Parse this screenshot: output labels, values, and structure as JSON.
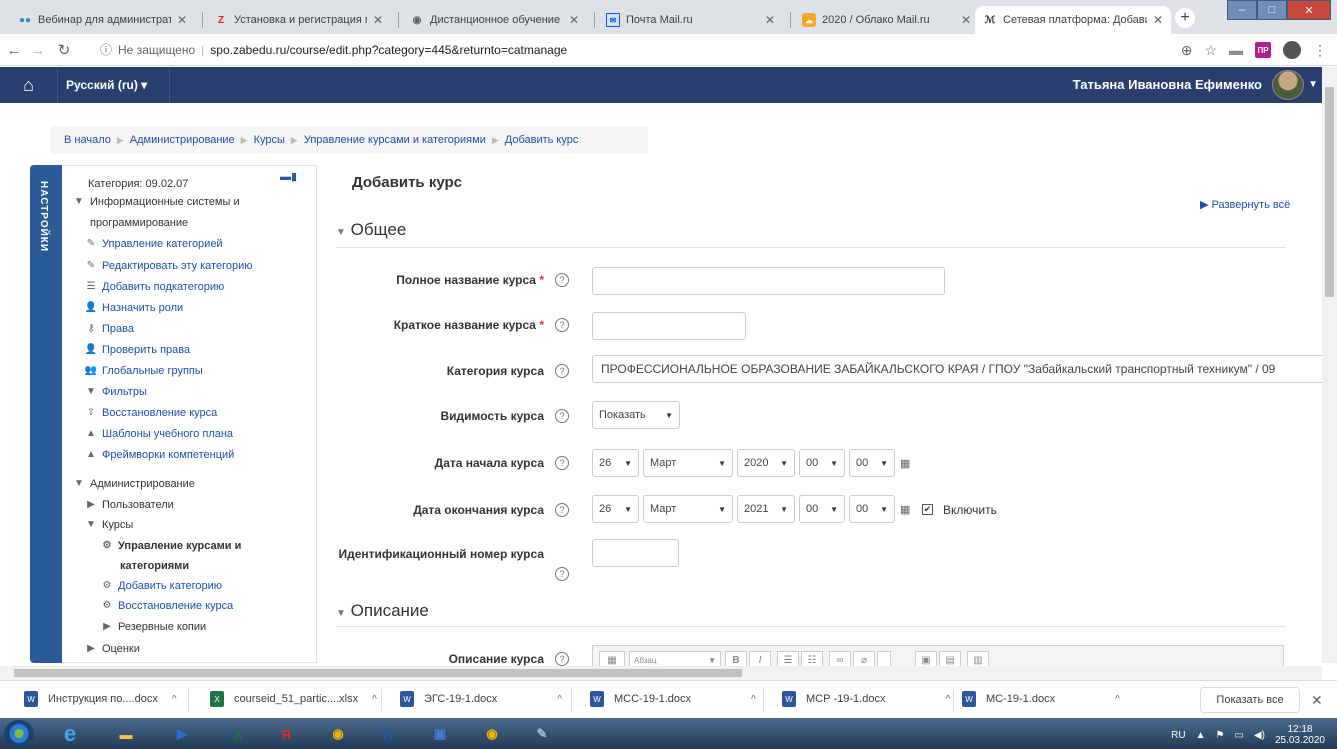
{
  "browser": {
    "tabs": [
      {
        "label": "Вебинар для администраторо",
        "icon": "webinar-icon",
        "active": false
      },
      {
        "label": "Установка и регистрация моб",
        "icon": "zoom-icon",
        "active": false
      },
      {
        "label": "Дистанционное обучение - ЧТ",
        "icon": "globe-icon",
        "active": false
      },
      {
        "label": "Почта Mail.ru",
        "icon": "mail-icon",
        "active": false
      },
      {
        "label": "2020 / Облако Mail.ru",
        "icon": "cloud-icon",
        "active": false
      },
      {
        "label": "Сетевая платформа: Добавить",
        "icon": "moodle-icon",
        "active": true
      }
    ],
    "address": {
      "insecure_label": "Не защищено",
      "url": "spo.zabedu.ru/course/edit.php?category=445&returnto=catmanage"
    }
  },
  "navbar": {
    "language": "Русский (ru) ▾",
    "username": "Татьяна Ивановна Ефименко"
  },
  "breadcrumb": [
    "В начало",
    "Администрирование",
    "Курсы",
    "Управление курсами и категориями",
    "Добавить курс"
  ],
  "settings": {
    "tab_label": "НАСТРОЙКИ",
    "category_title": "Категория: 09.02.07",
    "category_name_line1": "Информационные системы и",
    "category_name_line2": "программирование",
    "items": [
      "Управление категорией",
      "Редактировать эту категорию",
      "Добавить подкатегорию",
      "Назначить роли",
      "Права",
      "Проверить права",
      "Глобальные группы",
      "Фильтры",
      "Восстановление курса",
      "Шаблоны учебного плана",
      "Фреймворки компетенций"
    ],
    "admin": "Администрирование",
    "users": "Пользователи",
    "courses": "Курсы",
    "manage_courses_line1": "Управление курсами и",
    "manage_courses_line2": "категориями",
    "add_category": "Добавить категорию",
    "restore_course": "Восстановление курса",
    "backups": "Резервные копии",
    "grades": "Оценки"
  },
  "form": {
    "title": "Добавить курс",
    "expand_all": "Развернуть всё",
    "section_general": "Общее",
    "section_description": "Описание",
    "fullname_label": "Полное название курса",
    "shortname_label": "Краткое название курса",
    "category_label": "Категория курса",
    "category_value": "ПРОФЕССИОНАЛЬНОЕ ОБРАЗОВАНИЕ ЗАБАЙКАЛЬСКОГО КРАЯ / ГПОУ \"Забайкальский транспортный техникум\" / 09",
    "visibility_label": "Видимость курса",
    "visibility_value": "Показать",
    "start_label": "Дата начала курса",
    "start": {
      "day": "26",
      "month": "Март",
      "year": "2020",
      "hour": "00",
      "minute": "00"
    },
    "end_label": "Дата окончания курса",
    "end": {
      "day": "26",
      "month": "Март",
      "year": "2021",
      "hour": "00",
      "minute": "00"
    },
    "enable_label": "Включить",
    "idnumber_label": "Идентификационный номер курса",
    "summary_label": "Описание курса",
    "editor_paragraph": "Абзац"
  },
  "downloads": {
    "items": [
      {
        "name": "Инструкция по....docx",
        "type": "docx"
      },
      {
        "name": "courseid_51_partic....xlsx",
        "type": "xlsx"
      },
      {
        "name": "ЭГС-19-1.docx",
        "type": "docx"
      },
      {
        "name": "МСС-19-1.docx",
        "type": "docx"
      },
      {
        "name": "МСР -19-1.docx",
        "type": "docx"
      },
      {
        "name": "МС-19-1.docx",
        "type": "docx"
      }
    ],
    "show_all": "Показать все"
  },
  "taskbar": {
    "lang": "RU",
    "time": "12:18",
    "date": "25.03.2020"
  },
  "colors": {
    "navbar": "#2a3e6e",
    "link": "#1e50a2",
    "settings_tab": "#2a5b98",
    "required": "#dd3333"
  }
}
